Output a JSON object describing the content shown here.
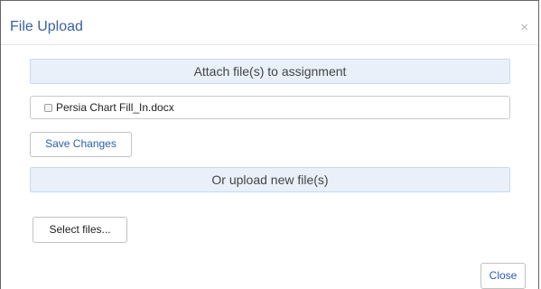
{
  "dialog": {
    "title": "File Upload",
    "close_glyph": "×",
    "attach_heading": "Attach file(s) to assignment",
    "files": [
      {
        "name": "Persia Chart Fill_In.docx",
        "checked": false
      }
    ],
    "save_label": "Save Changes",
    "upload_heading": "Or upload new file(s)",
    "select_label": "Select files...",
    "close_label": "Close"
  },
  "colors": {
    "title": "#3a63a0",
    "section_bg": "#e9f0fa",
    "button_link": "#2a5db0"
  },
  "icons": {
    "close": "close-icon",
    "checkbox": "checkbox-unchecked"
  }
}
